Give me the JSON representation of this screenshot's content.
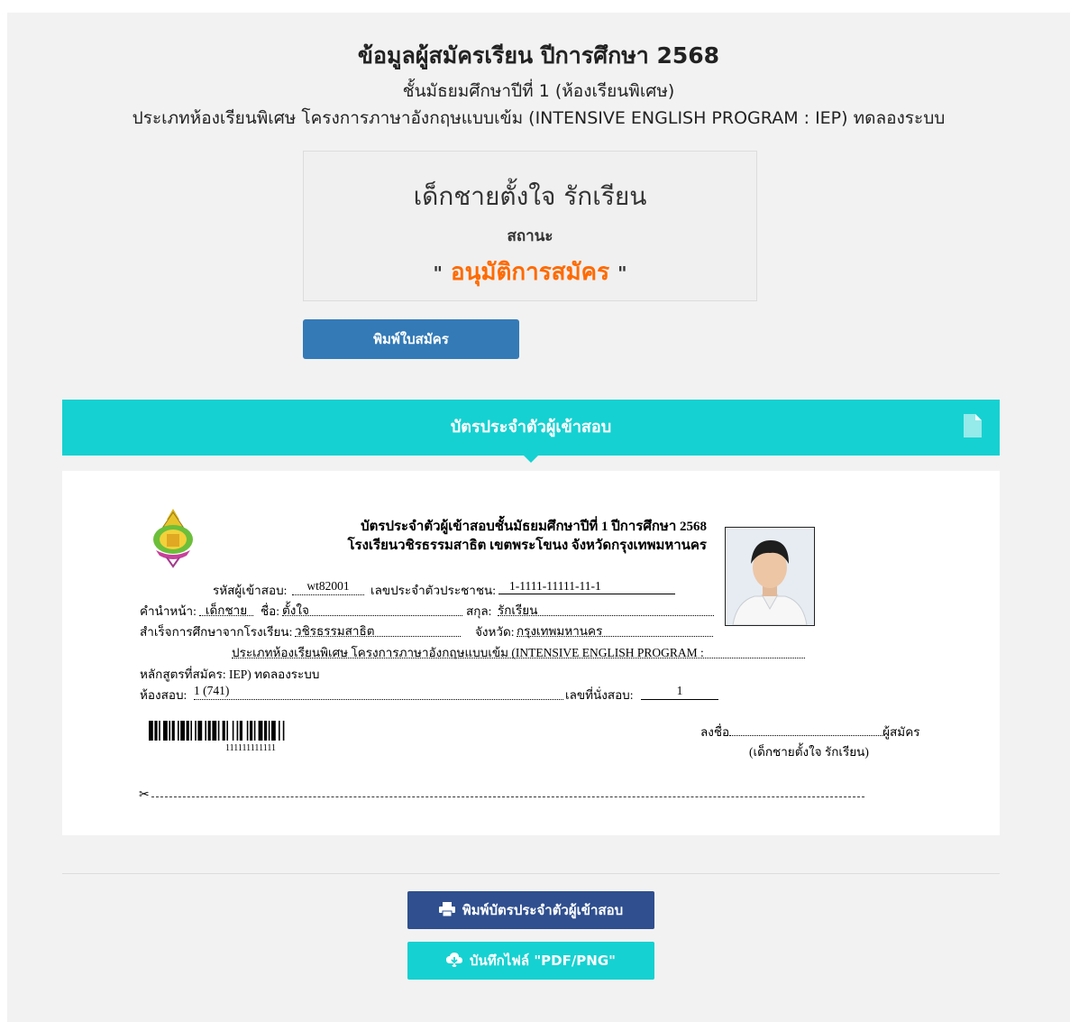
{
  "header": {
    "title": "ข้อมูลผู้สมัครเรียน ปีการศึกษา 2568",
    "subtitle": "ชั้นมัธยมศึกษาปีที่ 1 (ห้องเรียนพิเศษ)",
    "program": "ประเภทห้องเรียนพิเศษ โครงการภาษาอังกฤษแบบเข้ม (INTENSIVE ENGLISH PROGRAM : IEP) ทดลองระบบ"
  },
  "status_box": {
    "name": "เด็กชายตั้งใจ รักเรียน",
    "label": "สถานะ",
    "quote_open": "\"",
    "status": "อนุมัติการสมัคร",
    "quote_close": "\"",
    "status_color": "#ff6a00"
  },
  "buttons": {
    "print_application": "พิมพ์ใบสมัคร",
    "print_card": "พิมพ์บัตรประจำตัวผู้เข้าสอบ",
    "save_file": "บันทึกไฟล์ \"PDF/PNG\""
  },
  "card": {
    "header_title": "บัตรประจำตัวผู้เข้าสอบ",
    "header_icon": "document-icon",
    "header_color": "#16d1d1",
    "id_title_line1": "บัตรประจำตัวผู้เข้าสอบชั้นมัธยมศึกษาปีที่ 1 ปีการศึกษา 2568",
    "id_title_line2": "โรงเรียนวชิรธรรมสาธิต เขตพระโขนง จังหวัดกรุงเทพมหานคร",
    "exam_id_label": "รหัสผู้เข้าสอบ:",
    "exam_id": "wt82001",
    "citizen_id_label": "เลขประจำตัวประชาชน:",
    "citizen_id": "1-1111-11111-11-1",
    "prefix_label": "คำนำหน้า:",
    "prefix": "เด็กชาย",
    "first_name_label": "ชื่อ:",
    "first_name": "ตั้งใจ",
    "last_name_label": "สกุล:",
    "last_name": "รักเรียน",
    "school_label": "สำเร็จการศึกษาจากโรงเรียน:",
    "school": "วชิรธรรมสาธิต",
    "province_label": "จังหวัด:",
    "province": "กรุงเทพมหานคร",
    "program_line1": "ประเภทห้องเรียนพิเศษ โครงการภาษาอังกฤษแบบเข้ม (INTENSIVE ENGLISH PROGRAM :",
    "program_line2": "หลักสูตรที่สมัคร: IEP) ทดลองระบบ",
    "room_label": "ห้องสอบ:",
    "room": "1 (741)",
    "seat_label": "เลขที่นั่งสอบ:",
    "seat": "1",
    "barcode_number": "111111111111",
    "signature_prefix": "ลงชื่อ",
    "signature_suffix": "ผู้สมัคร",
    "signature_name": "(เด็กชายตั้งใจ รักเรียน)",
    "cut_icon": "scissors-icon"
  }
}
